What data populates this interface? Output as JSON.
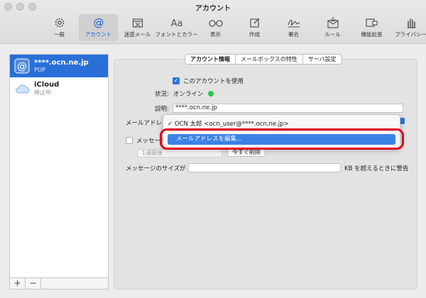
{
  "window": {
    "title": "アカウント"
  },
  "toolbar": {
    "items": [
      {
        "label": "一般",
        "icon": "gear-icon"
      },
      {
        "label": "アカウント",
        "icon": "at-icon",
        "selected": true
      },
      {
        "label": "迷惑メール",
        "icon": "junk-icon"
      },
      {
        "label": "フォントとカラー",
        "icon": "fonts-icon"
      },
      {
        "label": "表示",
        "icon": "glasses-icon"
      },
      {
        "label": "作成",
        "icon": "compose-icon"
      },
      {
        "label": "署名",
        "icon": "signature-icon"
      },
      {
        "label": "ルール",
        "icon": "rules-icon"
      },
      {
        "label": "機能拡張",
        "icon": "extensions-icon"
      },
      {
        "label": "プライバシー",
        "icon": "privacy-icon"
      }
    ]
  },
  "sidebar": {
    "accounts": [
      {
        "name": "****.ocn.ne.jp",
        "sub": "POP",
        "selected": true
      },
      {
        "name": "iCloud",
        "sub": "停止中"
      }
    ],
    "add_label": "+",
    "remove_label": "−"
  },
  "tabs": [
    {
      "label": "アカウント情報",
      "selected": true
    },
    {
      "label": "メールボックスの特性"
    },
    {
      "label": "サーバ設定"
    }
  ],
  "form": {
    "enable_label": "このアカウントを使用",
    "status_label": "状況:",
    "status_value": "オンライン",
    "description_label": "説明:",
    "description_value": "****.ocn.ne.jp",
    "email_label": "メールアドレス",
    "message_label": "メッセージ",
    "period_value": "1週間後",
    "delete_now_label": "今すぐ削除",
    "size_label": "メッセージのサイズが",
    "size_suffix": "KB を超えるときに警告"
  },
  "menu": {
    "current": "✓ OCN 太郎 <ocn_user@****.ocn.ne.jp>",
    "edit": "メールアドレスを編集..."
  },
  "colors": {
    "accent": "#2a73e0",
    "highlight": "#3a82e6",
    "annotation": "#e0001b",
    "online": "#2fc44f"
  }
}
